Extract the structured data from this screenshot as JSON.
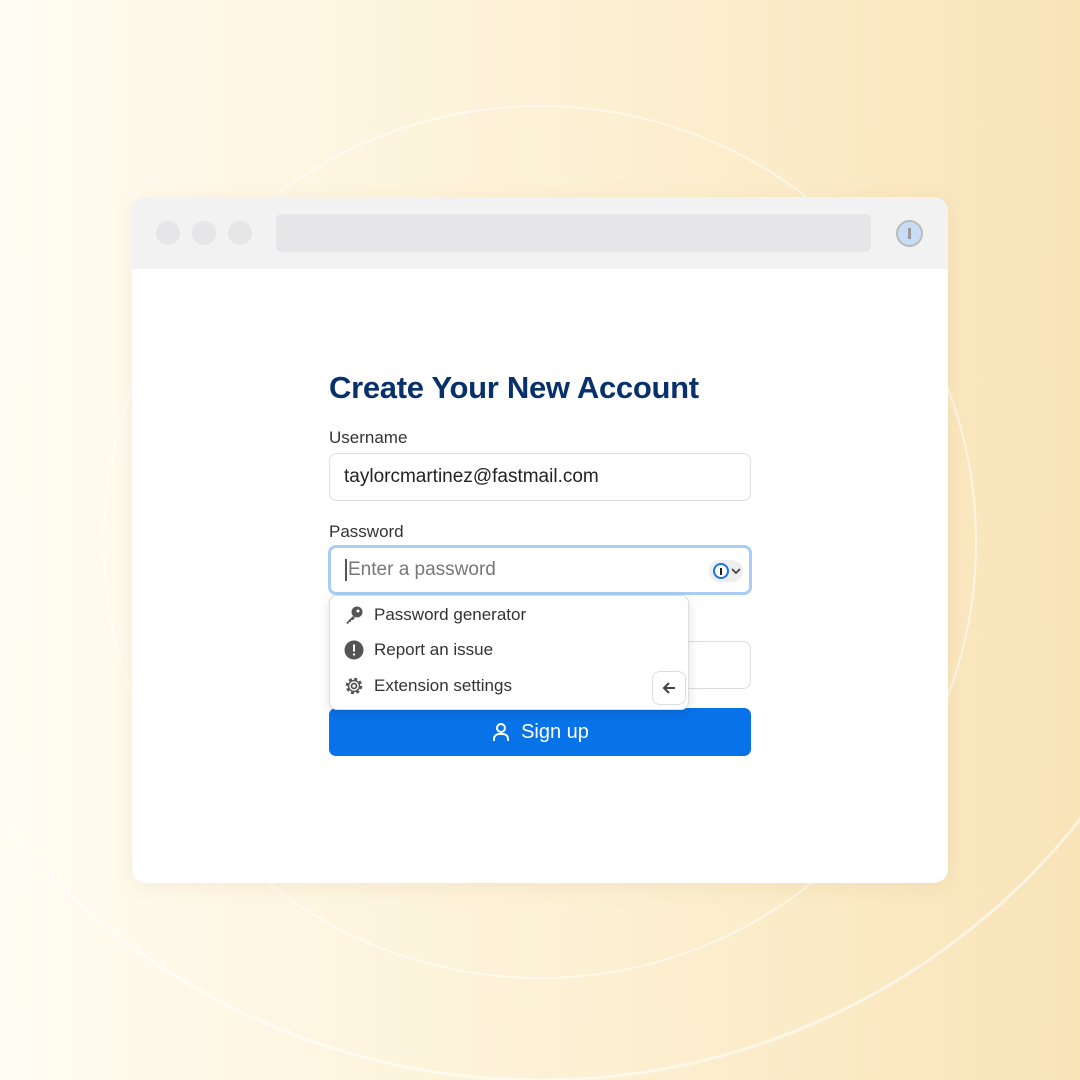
{
  "browser": {
    "extension_icon": "1password-icon"
  },
  "form": {
    "title": "Create Your New Account",
    "username_label": "Username",
    "username_value": "taylorcmartinez@fastmail.com",
    "password_label": "Password",
    "password_placeholder": "Enter a password",
    "submit_label": "Sign up"
  },
  "menu": {
    "items": [
      {
        "label": "Password generator",
        "icon": "key-icon"
      },
      {
        "label": "Report an issue",
        "icon": "alert-icon"
      },
      {
        "label": "Extension settings",
        "icon": "gear-icon"
      }
    ]
  },
  "colors": {
    "accent": "#0872e8",
    "title": "#08316b"
  }
}
